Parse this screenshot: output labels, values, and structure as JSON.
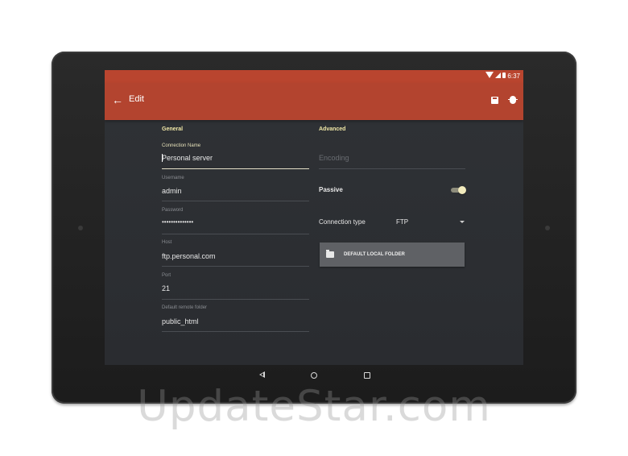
{
  "status_bar": {
    "time": "6:37"
  },
  "app_bar": {
    "title": "Edit"
  },
  "general": {
    "section_title": "General",
    "connection_name": {
      "label": "Connection Name",
      "value": "Personal server"
    },
    "username": {
      "label": "Username",
      "value": "admin"
    },
    "password": {
      "label": "Password",
      "value": "••••••••••••••"
    },
    "host": {
      "label": "Host",
      "value": "ftp.personal.com"
    },
    "port": {
      "label": "Port",
      "value": "21"
    },
    "remote_folder": {
      "label": "Default remote folder",
      "value": "public_html"
    }
  },
  "advanced": {
    "section_title": "Advanced",
    "encoding": {
      "placeholder": "Encoding"
    },
    "passive": {
      "label": "Passive",
      "enabled": true
    },
    "connection_type": {
      "label": "Connection type",
      "value": "FTP"
    },
    "local_folder_button": "DEFAULT LOCAL FOLDER"
  },
  "watermark": "UpdateStar.com",
  "colors": {
    "accent": "#b3442f",
    "highlight": "#f0e7a6",
    "background": "#2d3034"
  }
}
